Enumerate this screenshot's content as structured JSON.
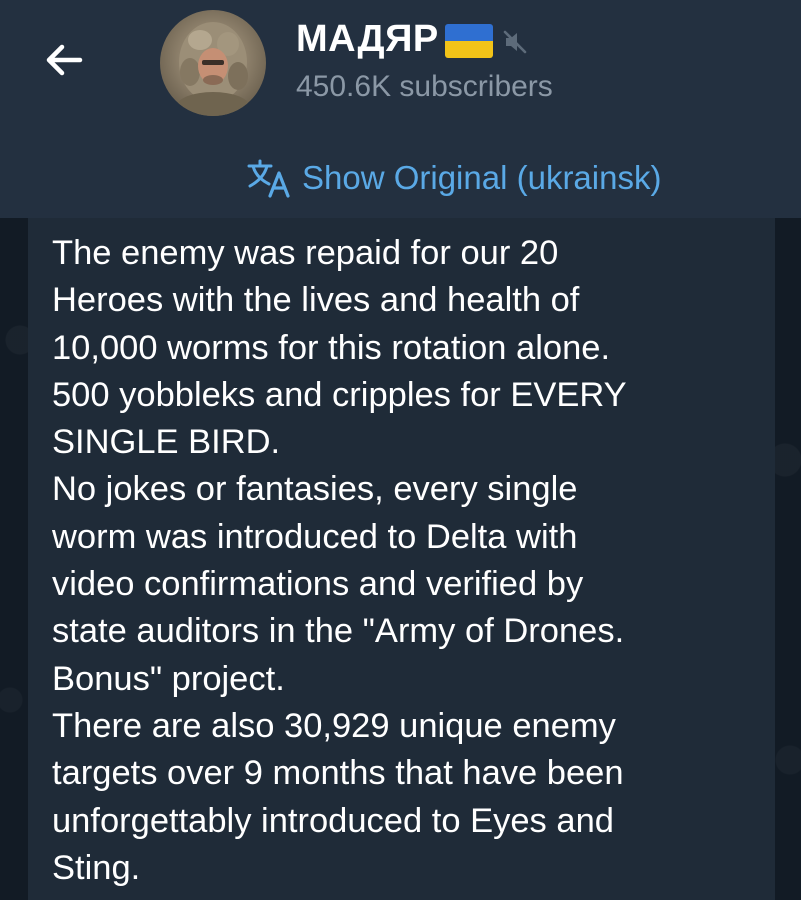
{
  "header": {
    "channel_name": "МАДЯР",
    "subscribers": "450.6K subscribers",
    "translate_label": "Show Original (ukrainsk)"
  },
  "message": {
    "text": "The enemy was repaid for our 20\nHeroes with the lives and health of\n10,000 worms for this rotation alone.\n500 yobbleks and cripples for EVERY\nSINGLE BIRD.\nNo jokes or fantasies, every single\nworm was introduced to Delta with\nvideo confirmations and verified by\nstate auditors in the \"Army of Drones.\nBonus\" project.\nThere are also 30,929 unique enemy\ntargets over 9 months that have been\nunforgettably introduced to Eyes and\nSting."
  },
  "icons": {
    "back": "arrow-left-icon",
    "flag": "ukraine-flag-icon",
    "mute": "muted-speaker-icon",
    "translate": "translate-icon"
  },
  "colors": {
    "header_bg": "#233040",
    "chat_bg": "#121b25",
    "bubble_bg": "#1f2b38",
    "accent": "#5aa9e6",
    "secondary_text": "#8b98a6",
    "flag_blue": "#2f6fd1",
    "flag_yellow": "#f2c318"
  }
}
